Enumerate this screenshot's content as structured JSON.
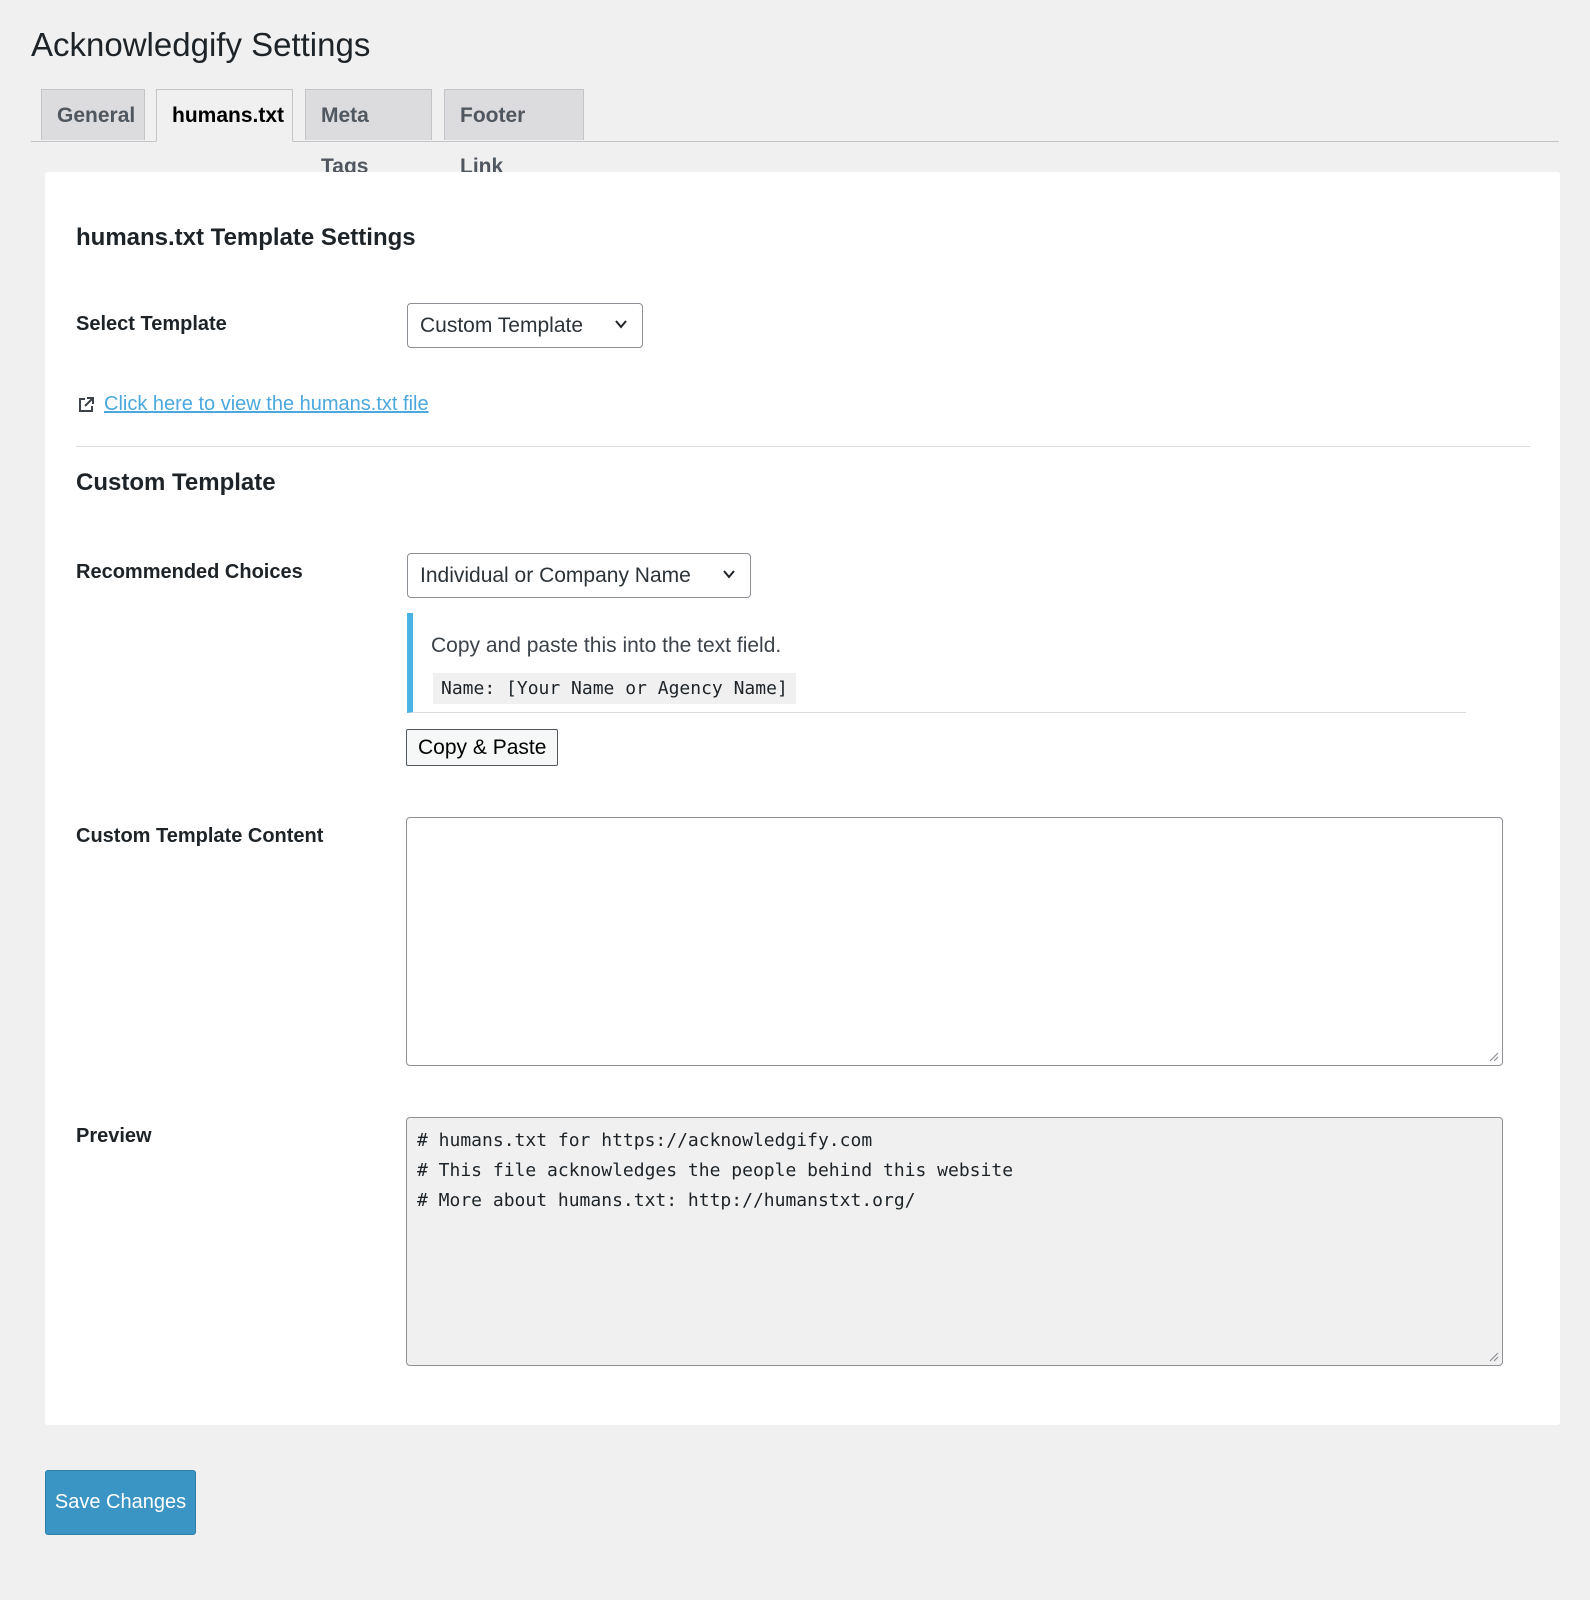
{
  "page": {
    "title": "Acknowledgify Settings"
  },
  "tabs": [
    {
      "label": "General",
      "active": false
    },
    {
      "label": "humans.txt",
      "active": true
    },
    {
      "label": "Meta Tags",
      "active": false
    },
    {
      "label": "Footer Link",
      "active": false
    }
  ],
  "template_settings": {
    "heading": "humans.txt Template Settings",
    "select_label": "Select Template",
    "select_value": "Custom Template",
    "view_link_text": "Click here to view the humans.txt file",
    "view_link_icon": "external-link-icon"
  },
  "custom_template": {
    "heading": "Custom Template",
    "choices_label": "Recommended Choices",
    "choices_value": "Individual or Company Name",
    "notice_text": "Copy and paste this into the text field.",
    "notice_code": "Name: [Your Name or Agency Name]",
    "copy_button": "Copy & Paste",
    "content_label": "Custom Template Content",
    "content_value": ""
  },
  "preview": {
    "label": "Preview",
    "lines": "# humans.txt for https://acknowledgify.com\n# This file acknowledges the people behind this website\n# More about humans.txt: http://humanstxt.org/"
  },
  "actions": {
    "save_label": "Save Changes"
  },
  "colors": {
    "background": "#f0f0f1",
    "link": "#4aa8de",
    "notice_accent": "#4ab3e6",
    "primary_button": "#3a95c4"
  }
}
